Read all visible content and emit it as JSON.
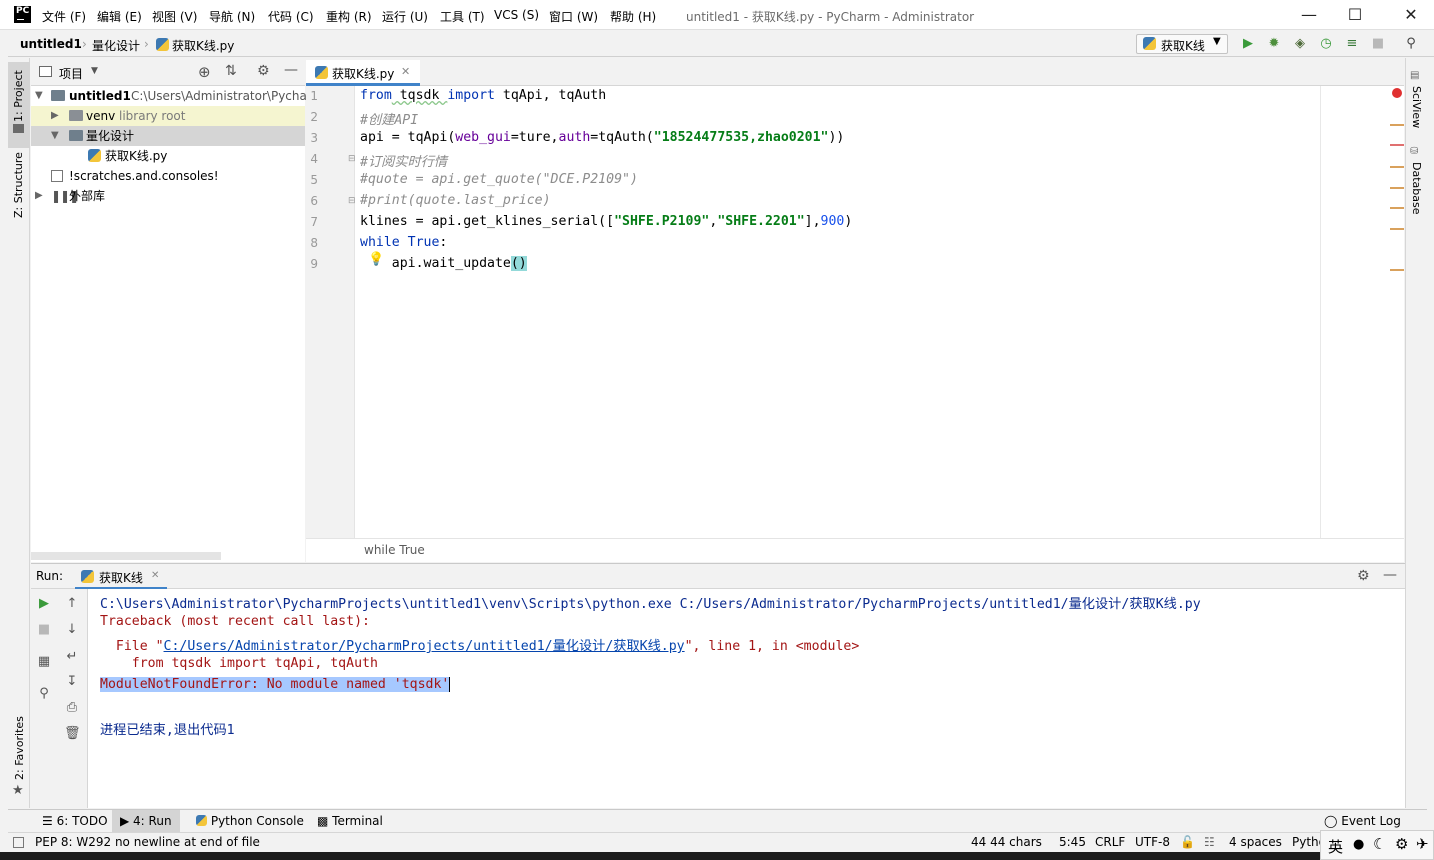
{
  "window": {
    "title": "untitled1 - 获取K线.py - PyCharm - Administrator",
    "logo_text": "PC",
    "menus": [
      "文件 (F)",
      "编辑 (E)",
      "视图 (V)",
      "导航 (N)",
      "代码 (C)",
      "重构 (R)",
      "运行 (U)",
      "工具 (T)",
      "VCS (S)",
      "窗口 (W)",
      "帮助 (H)"
    ]
  },
  "navbar": {
    "crumbs": [
      "untitled1",
      "量化设计",
      "获取K线.py"
    ],
    "run_config": "获取K线"
  },
  "left_strip": {
    "project": "1: Project",
    "structure": "Z: Structure",
    "favorites": "2: Favorites"
  },
  "right_strip": {
    "sciview": "SciView",
    "database": "Database"
  },
  "project": {
    "header": "项目",
    "tree": {
      "root": "untitled1",
      "root_path": "C:\\Users\\Administrator\\Pycharm",
      "venv": "venv",
      "venv_hint": "library root",
      "folder": "量化设计",
      "file": "获取K线.py",
      "scratches": "!scratches.and.consoles!",
      "external": "外部库"
    }
  },
  "editor": {
    "tab": "获取K线.py",
    "line_numbers": [
      "1",
      "2",
      "3",
      "4",
      "5",
      "6",
      "7",
      "8",
      "9"
    ],
    "lines": {
      "l1": {
        "a": "from",
        "b": " tqsdk ",
        "c": "import",
        "d": " tqApi, tqAuth"
      },
      "l2": "#创建API",
      "l3": {
        "a": "api = tqApi(",
        "b": "web_gui",
        "c": "=ture,",
        "d": "auth",
        "e": "=tqAuth(",
        "f": "\"18524477535,zhao0201\"",
        "g": "))"
      },
      "l4": "#订阅实时行情",
      "l5": "#quote = api.get_quote(\"DCE.P2109\")",
      "l6": "#print(quote.last_price)",
      "l7": {
        "a": "klines = api.get_klines_serial([",
        "b": "\"SHFE.P2109\"",
        "c": ",",
        "d": "\"SHFE.2201\"",
        "e": "],",
        "f": "900",
        "g": ")"
      },
      "l8": {
        "a": "while",
        "b": " ",
        "c": "True",
        ":": ":"
      },
      "l9": {
        "a": "api.wait_update",
        "b": "()"
      }
    },
    "breadcrumb": "while True"
  },
  "run": {
    "label": "Run:",
    "tab": "获取K线",
    "output": {
      "cmd": "C:\\Users\\Administrator\\PycharmProjects\\untitled1\\venv\\Scripts\\python.exe C:/Users/Administrator/PycharmProjects/untitled1/量化设计/获取K线.py",
      "tb1": "Traceback (most recent call last):",
      "tb2a": "  File \"",
      "tb2link": "C:/Users/Administrator/PycharmProjects/untitled1/量化设计/获取K线.py",
      "tb2b": "\", line 1, in <module>",
      "tb3": "    from tqsdk import tqApi, tqAuth",
      "err": "ModuleNotFoundError: No module named 'tqsdk'",
      "exit": "进程已结束,退出代码1"
    }
  },
  "bottom_tabs": {
    "todo": "6: TODO",
    "run": "4: Run",
    "python_console": "Python Console",
    "terminal": "Terminal",
    "event_log": "Event Log"
  },
  "status": {
    "message": "PEP 8: W292 no newline at end of file",
    "chars": "44 44 chars",
    "position": "5:45",
    "line_sep": "CRLF",
    "encoding": "UTF-8",
    "indent": "4 spaces",
    "interpreter": "Pytho"
  },
  "ime": {
    "lang": "英"
  },
  "colors": {
    "keyword": "#0033b3",
    "string": "#067d17",
    "comment": "#8c8c8c",
    "error_text": "#a31515",
    "link": "#0645ad",
    "selection": "#a6c8ff",
    "accent": "#4083c9"
  }
}
